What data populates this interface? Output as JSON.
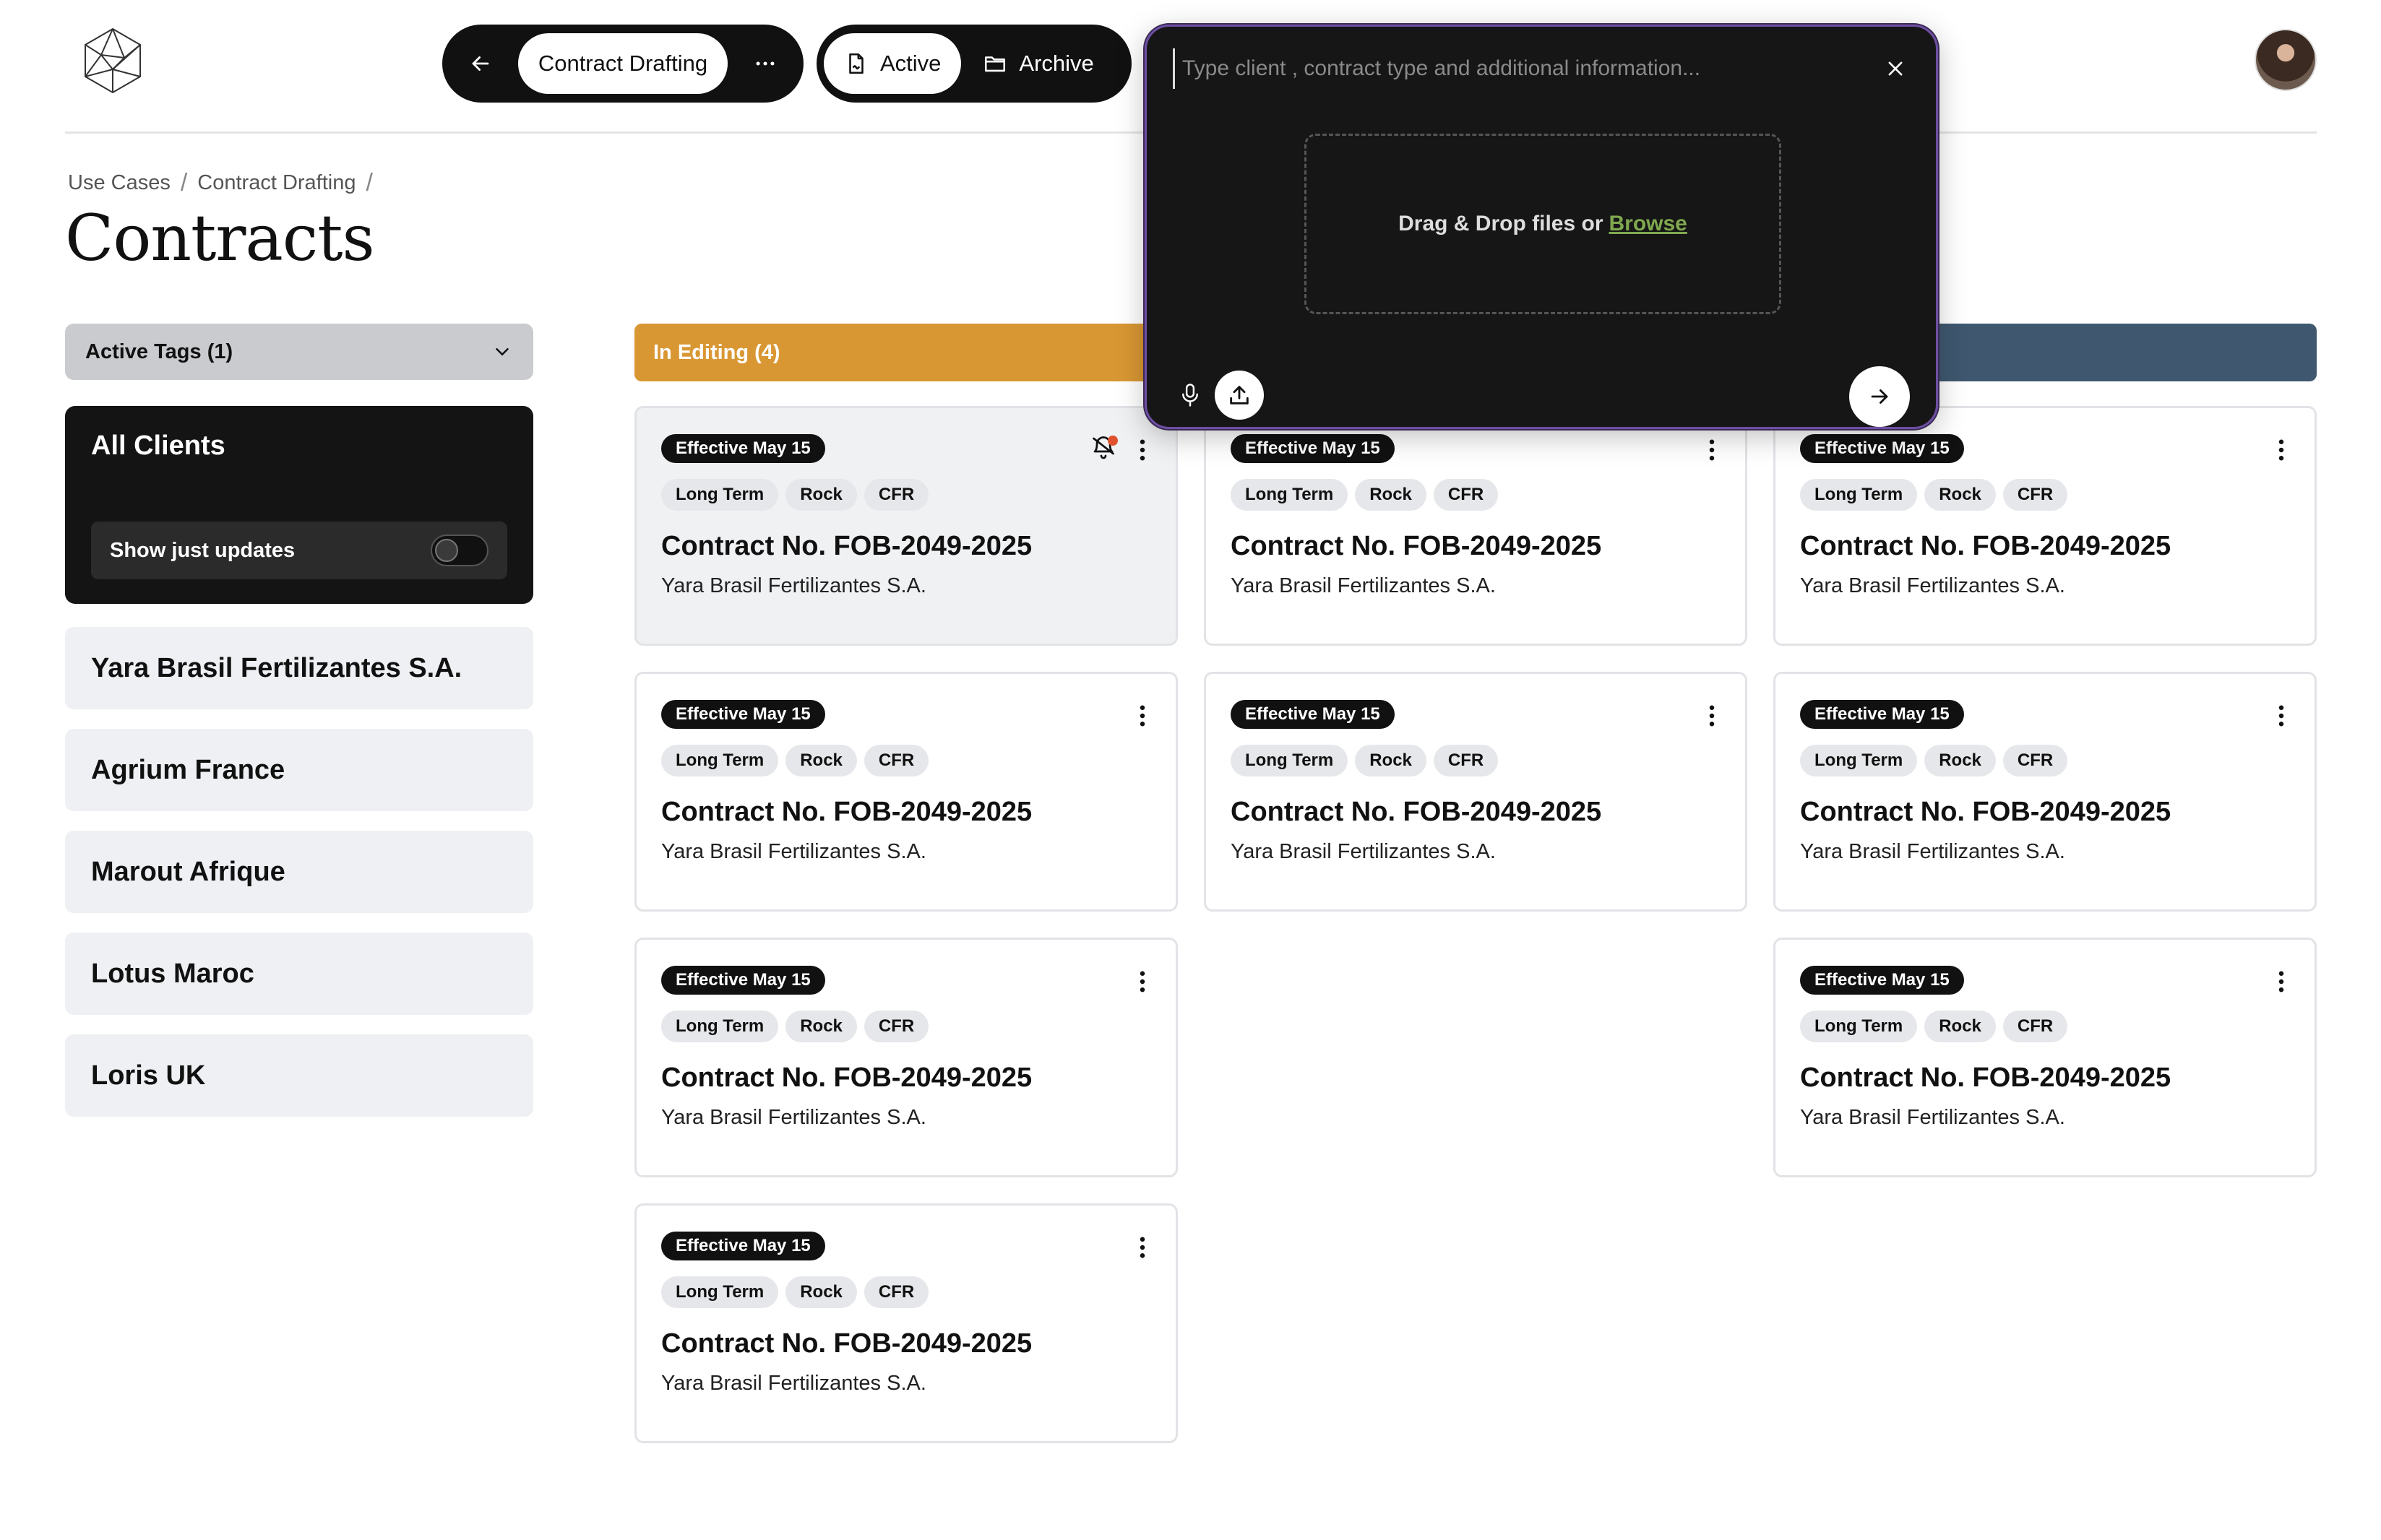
{
  "nav": {
    "section_label": "Contract Drafting",
    "active_label": "Active",
    "archive_label": "Archive"
  },
  "breadcrumb": [
    "Use Cases",
    "Contract Drafting"
  ],
  "page_title": "Contracts",
  "sidebar": {
    "tags_label": "Active Tags (1)",
    "clients_title": "All Clients",
    "updates_label": "Show just updates",
    "updates_on": false,
    "clients": [
      "Yara Brasil Fertilizantes S.A.",
      "Agrium France",
      "Marout Afrique",
      "Lotus Maroc",
      "Loris UK"
    ]
  },
  "columns": {
    "editing_label": "In Editing (4)",
    "editing_color": "#d99734",
    "third_color": "#3f586f"
  },
  "cards": [
    {
      "badge": "Effective May 15",
      "tags": [
        "Long Term",
        "Rock",
        "CFR"
      ],
      "title": "Contract No. FOB-2049-2025",
      "client": "Yara Brasil Fertilizantes S.A.",
      "notification": true
    },
    {
      "badge": "Effective May 15",
      "tags": [
        "Long Term",
        "Rock",
        "CFR"
      ],
      "title": "Contract No. FOB-2049-2025",
      "client": "Yara Brasil Fertilizantes S.A."
    },
    {
      "badge": "Effective May 15",
      "tags": [
        "Long Term",
        "Rock",
        "CFR"
      ],
      "title": "Contract No. FOB-2049-2025",
      "client": "Yara Brasil Fertilizantes S.A."
    },
    {
      "badge": "Effective May 15",
      "tags": [
        "Long Term",
        "Rock",
        "CFR"
      ],
      "title": "Contract No. FOB-2049-2025",
      "client": "Yara Brasil Fertilizantes S.A."
    },
    {
      "badge": "Effective May 15",
      "tags": [
        "Long Term",
        "Rock",
        "CFR"
      ],
      "title": "Contract No. FOB-2049-2025",
      "client": "Yara Brasil Fertilizantes S.A."
    },
    {
      "badge": "Effective May 15",
      "tags": [
        "Long Term",
        "Rock",
        "CFR"
      ],
      "title": "Contract No. FOB-2049-2025",
      "client": "Yara Brasil Fertilizantes S.A."
    },
    {
      "badge": "Effective May 15",
      "tags": [
        "Long Term",
        "Rock",
        "CFR"
      ],
      "title": "Contract No. FOB-2049-2025",
      "client": "Yara Brasil Fertilizantes S.A."
    },
    {
      "badge": "Effective May 15",
      "tags": [
        "Long Term",
        "Rock",
        "CFR"
      ],
      "title": "Contract No. FOB-2049-2025",
      "client": "Yara Brasil Fertilizantes S.A."
    },
    {
      "badge": "Effective May 15",
      "tags": [
        "Long Term",
        "Rock",
        "CFR"
      ],
      "title": "Contract No. FOB-2049-2025",
      "client": "Yara Brasil Fertilizantes S.A."
    }
  ],
  "prompt": {
    "placeholder": "Type client , contract type and additional information...",
    "drop_text": "Drag & Drop files or",
    "browse_label": "Browse"
  },
  "icons": {
    "back": "arrow-left-icon",
    "more": "more-horizontal-icon",
    "active": "file-signature-icon",
    "archive": "folder-icon",
    "close": "close-icon",
    "mic": "microphone-icon",
    "upload": "upload-icon",
    "send": "arrow-right-icon",
    "card_menu": "kebab-icon",
    "notification": "bell-icon"
  }
}
